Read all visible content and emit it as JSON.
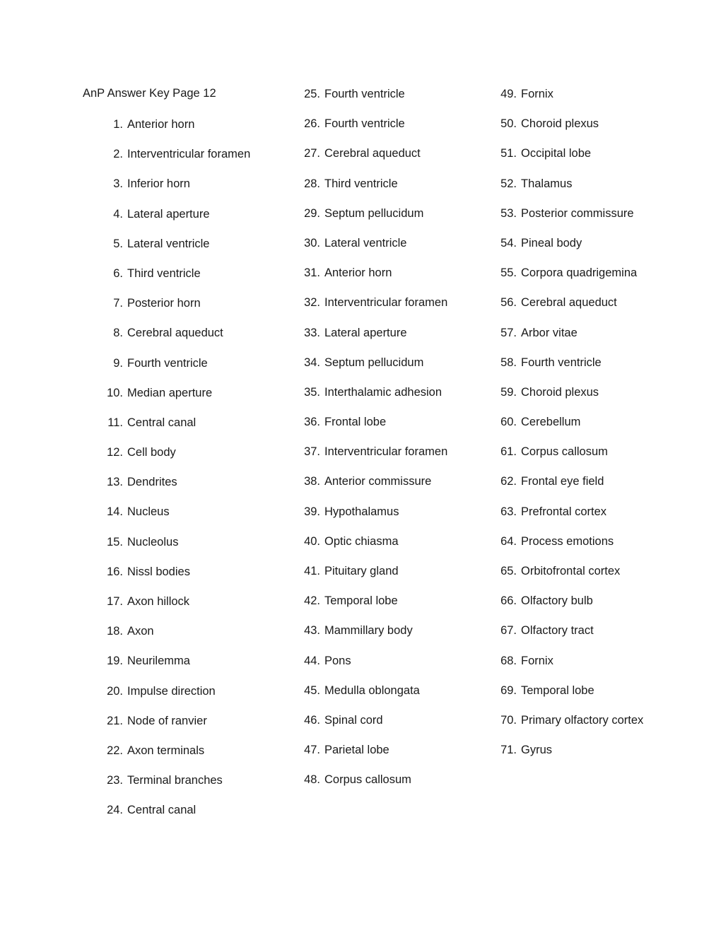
{
  "document": {
    "header": "AnP Answer Key Page 12",
    "page_background": "#ffffff",
    "text_color": "#1a1a1a"
  },
  "columns": [
    {
      "id": "column-1",
      "items": [
        {
          "num": "1.",
          "text": "Anterior horn"
        },
        {
          "num": "2.",
          "text": "Interventricular foramen"
        },
        {
          "num": "3.",
          "text": "Inferior horn"
        },
        {
          "num": "4.",
          "text": "Lateral aperture"
        },
        {
          "num": "5.",
          "text": "Lateral ventricle"
        },
        {
          "num": "6.",
          "text": "Third ventricle"
        },
        {
          "num": "7.",
          "text": "Posterior horn"
        },
        {
          "num": "8.",
          "text": "Cerebral aqueduct"
        },
        {
          "num": "9.",
          "text": "Fourth ventricle"
        },
        {
          "num": "10.",
          "text": "Median aperture"
        },
        {
          "num": "11.",
          "text": "Central canal"
        },
        {
          "num": "12.",
          "text": "Cell body"
        },
        {
          "num": "13.",
          "text": "Dendrites"
        },
        {
          "num": "14.",
          "text": "Nucleus"
        },
        {
          "num": "15.",
          "text": "Nucleolus"
        },
        {
          "num": "16.",
          "text": "Nissl bodies"
        },
        {
          "num": "17.",
          "text": "Axon hillock"
        },
        {
          "num": "18.",
          "text": "Axon"
        },
        {
          "num": "19.",
          "text": "Neurilemma"
        },
        {
          "num": "20.",
          "text": "Impulse direction"
        },
        {
          "num": "21.",
          "text": "Node of ranvier"
        },
        {
          "num": "22.",
          "text": "Axon terminals"
        },
        {
          "num": "23.",
          "text": "Terminal branches"
        },
        {
          "num": "24.",
          "text": "Central canal"
        }
      ]
    },
    {
      "id": "column-2",
      "items": [
        {
          "num": "25.",
          "text": "Fourth ventricle"
        },
        {
          "num": "26.",
          "text": "Fourth ventricle"
        },
        {
          "num": "27.",
          "text": "Cerebral aqueduct"
        },
        {
          "num": "28.",
          "text": "Third ventricle"
        },
        {
          "num": "29.",
          "text": "Septum pellucidum"
        },
        {
          "num": "30.",
          "text": "Lateral ventricle"
        },
        {
          "num": "31.",
          "text": "Anterior horn"
        },
        {
          "num": "32.",
          "text": "Interventricular foramen"
        },
        {
          "num": "33.",
          "text": "Lateral aperture"
        },
        {
          "num": "34.",
          "text": "Septum pellucidum"
        },
        {
          "num": "35.",
          "text": "Interthalamic adhesion"
        },
        {
          "num": "36.",
          "text": "Frontal lobe"
        },
        {
          "num": "37.",
          "text": "Interventricular foramen"
        },
        {
          "num": "38.",
          "text": "Anterior commissure"
        },
        {
          "num": "39.",
          "text": "Hypothalamus"
        },
        {
          "num": "40.",
          "text": "Optic chiasma"
        },
        {
          "num": "41.",
          "text": "Pituitary gland"
        },
        {
          "num": "42.",
          "text": "Temporal lobe"
        },
        {
          "num": "43.",
          "text": "Mammillary body"
        },
        {
          "num": "44.",
          "text": "Pons"
        },
        {
          "num": "45.",
          "text": "Medulla oblongata"
        },
        {
          "num": "46.",
          "text": "Spinal cord"
        },
        {
          "num": "47.",
          "text": "Parietal lobe"
        },
        {
          "num": "48.",
          "text": "Corpus callosum"
        }
      ]
    },
    {
      "id": "column-3",
      "items": [
        {
          "num": "49.",
          "text": "Fornix"
        },
        {
          "num": "50.",
          "text": "Choroid plexus"
        },
        {
          "num": "51.",
          "text": "Occipital lobe"
        },
        {
          "num": "52.",
          "text": "Thalamus"
        },
        {
          "num": "53.",
          "text": "Posterior commissure"
        },
        {
          "num": "54.",
          "text": "Pineal body"
        },
        {
          "num": "55.",
          "text": "Corpora quadrigemina"
        },
        {
          "num": "56.",
          "text": "Cerebral aqueduct"
        },
        {
          "num": "57.",
          "text": "Arbor vitae"
        },
        {
          "num": "58.",
          "text": "Fourth ventricle"
        },
        {
          "num": "59.",
          "text": "Choroid plexus"
        },
        {
          "num": "60.",
          "text": "Cerebellum"
        },
        {
          "num": "61.",
          "text": "Corpus callosum"
        },
        {
          "num": "62.",
          "text": "Frontal eye field"
        },
        {
          "num": "63.",
          "text": "Prefrontal cortex"
        },
        {
          "num": "64.",
          "text": "Process emotions"
        },
        {
          "num": "65.",
          "text": "Orbitofrontal cortex"
        },
        {
          "num": "66.",
          "text": "Olfactory bulb"
        },
        {
          "num": "67.",
          "text": "Olfactory tract"
        },
        {
          "num": "68.",
          "text": "Fornix"
        },
        {
          "num": "69.",
          "text": "Temporal lobe"
        },
        {
          "num": "70.",
          "text": "Primary olfactory cortex"
        },
        {
          "num": "71.",
          "text": "Gyrus"
        }
      ]
    }
  ]
}
